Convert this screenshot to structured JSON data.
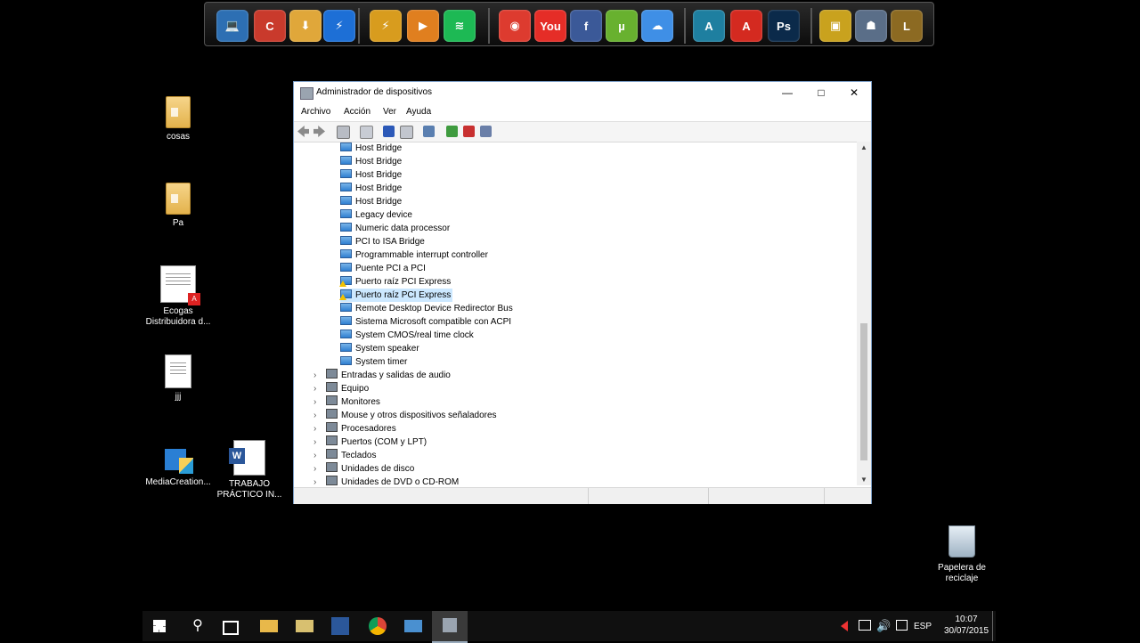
{
  "dock": {
    "icons": [
      {
        "name": "computer",
        "color": "#2d6fb3",
        "glyph": "💻"
      },
      {
        "name": "ccleaner",
        "color": "#c93a2c",
        "glyph": "C"
      },
      {
        "name": "download-folder",
        "color": "#e0a73a",
        "glyph": "⬇"
      },
      {
        "name": "flash",
        "color": "#1d6fd6",
        "glyph": "⚡"
      },
      {
        "name": "winamp",
        "color": "#d89c1e",
        "glyph": "⚡"
      },
      {
        "name": "media-player",
        "color": "#e07f1f",
        "glyph": "▶"
      },
      {
        "name": "spotify",
        "color": "#1db954",
        "glyph": "≋"
      },
      {
        "name": "chrome",
        "color": "#dd3b2f",
        "glyph": "◉"
      },
      {
        "name": "youtube",
        "color": "#e52d27",
        "glyph": "You"
      },
      {
        "name": "facebook",
        "color": "#3b5998",
        "glyph": "f"
      },
      {
        "name": "utorrent",
        "color": "#68b12f",
        "glyph": "µ"
      },
      {
        "name": "cloud-music",
        "color": "#3f8fe6",
        "glyph": "☁"
      },
      {
        "name": "autocad",
        "color": "#1e7fa0",
        "glyph": "A"
      },
      {
        "name": "acrobat",
        "color": "#d42a20",
        "glyph": "A"
      },
      {
        "name": "photoshop",
        "color": "#0b2a4a",
        "glyph": "Ps"
      },
      {
        "name": "game-folder",
        "color": "#c9a21e",
        "glyph": "▣"
      },
      {
        "name": "counter-strike",
        "color": "#5a6e88",
        "glyph": "☗"
      },
      {
        "name": "league-of-legends",
        "color": "#8c6a22",
        "glyph": "L"
      }
    ]
  },
  "desktop": {
    "icons": [
      {
        "label": "cosas"
      },
      {
        "label": "Pa"
      },
      {
        "label": "Ecogas Distribuidora d..."
      },
      {
        "label": "jjj"
      },
      {
        "label": "MediaCreation..."
      },
      {
        "label": "TRABAJO PRÁCTICO IN..."
      }
    ],
    "recycle_bin": "Papelera de reciclaje"
  },
  "window": {
    "title": "Administrador de dispositivos",
    "menu": [
      "Archivo",
      "Acción",
      "Ver",
      "Ayuda"
    ],
    "system_devices": [
      {
        "label": "Host Bridge",
        "warning": false,
        "selected": false
      },
      {
        "label": "Host Bridge",
        "warning": false,
        "selected": false
      },
      {
        "label": "Host Bridge",
        "warning": false,
        "selected": false
      },
      {
        "label": "Host Bridge",
        "warning": false,
        "selected": false
      },
      {
        "label": "Host Bridge",
        "warning": false,
        "selected": false
      },
      {
        "label": "Legacy device",
        "warning": false,
        "selected": false
      },
      {
        "label": "Numeric data processor",
        "warning": false,
        "selected": false
      },
      {
        "label": "PCI to ISA Bridge",
        "warning": false,
        "selected": false
      },
      {
        "label": "Programmable interrupt controller",
        "warning": false,
        "selected": false
      },
      {
        "label": "Puente PCI a PCI",
        "warning": false,
        "selected": false
      },
      {
        "label": "Puerto raíz PCI Express",
        "warning": true,
        "selected": false
      },
      {
        "label": "Puerto raíz PCI Express",
        "warning": true,
        "selected": true
      },
      {
        "label": "Remote Desktop Device Redirector Bus",
        "warning": false,
        "selected": false
      },
      {
        "label": "Sistema Microsoft compatible con ACPI",
        "warning": false,
        "selected": false
      },
      {
        "label": "System CMOS/real time clock",
        "warning": false,
        "selected": false
      },
      {
        "label": "System speaker",
        "warning": false,
        "selected": false
      },
      {
        "label": "System timer",
        "warning": false,
        "selected": false
      }
    ],
    "categories": [
      {
        "label": "Entradas y salidas de audio"
      },
      {
        "label": "Equipo"
      },
      {
        "label": "Monitores"
      },
      {
        "label": "Mouse y otros dispositivos señaladores"
      },
      {
        "label": "Procesadores"
      },
      {
        "label": "Puertos (COM y LPT)"
      },
      {
        "label": "Teclados"
      },
      {
        "label": "Unidades de disco"
      },
      {
        "label": "Unidades de DVD o CD-ROM"
      }
    ]
  },
  "taskbar": {
    "language": "ESP",
    "time": "10:07",
    "date": "30/07/2015"
  }
}
